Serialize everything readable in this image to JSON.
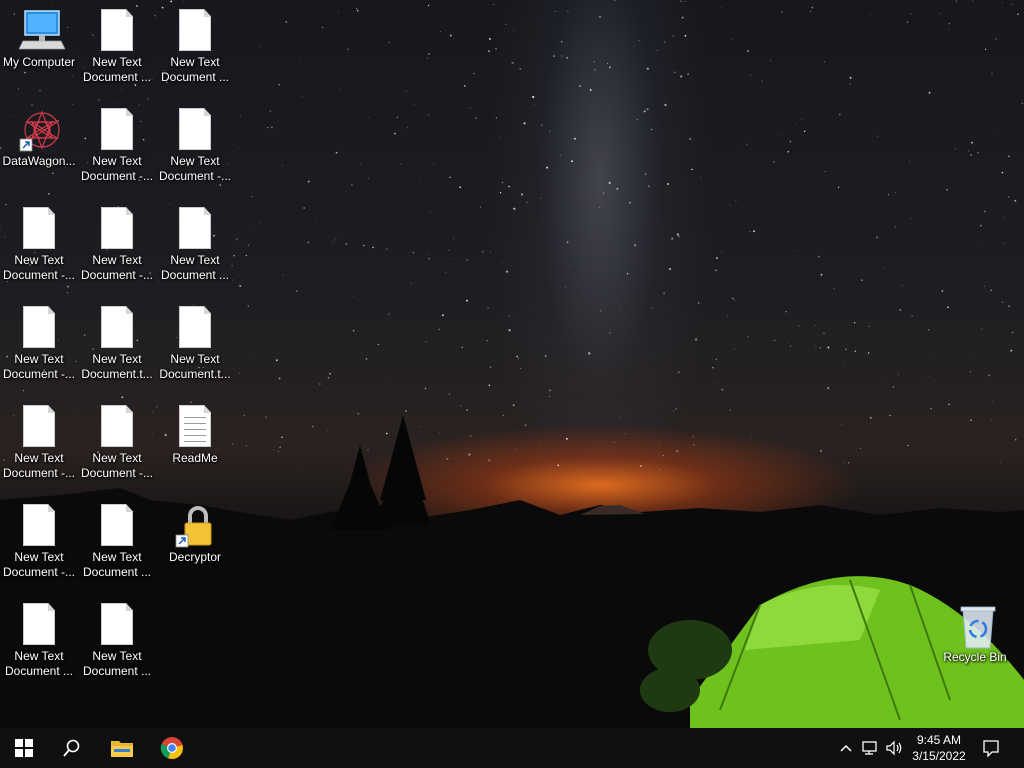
{
  "desktop": {
    "icons": [
      {
        "id": "my-computer",
        "label": "My Computer",
        "type": "computer"
      },
      {
        "id": "datawagon",
        "label": "DataWagon...",
        "type": "app"
      },
      {
        "id": "doc-c1r3",
        "label": "New Text\nDocument -...",
        "type": "doc"
      },
      {
        "id": "doc-c1r4",
        "label": "New Text\nDocument -...",
        "type": "doc"
      },
      {
        "id": "doc-c1r5",
        "label": "New Text\nDocument -...",
        "type": "doc"
      },
      {
        "id": "doc-c1r6",
        "label": "New Text\nDocument -...",
        "type": "doc"
      },
      {
        "id": "doc-c1r7",
        "label": "New Text\nDocument ...",
        "type": "doc"
      },
      {
        "id": "doc-c2r1",
        "label": "New Text\nDocument ...",
        "type": "doc"
      },
      {
        "id": "doc-c2r2",
        "label": "New Text\nDocument -...",
        "type": "doc"
      },
      {
        "id": "doc-c2r3",
        "label": "New Text\nDocument -...",
        "type": "doc"
      },
      {
        "id": "doc-c2r4",
        "label": "New Text\nDocument.t...",
        "type": "doc"
      },
      {
        "id": "doc-c2r5",
        "label": "New Text\nDocument -...",
        "type": "doc"
      },
      {
        "id": "doc-c2r6",
        "label": "New Text\nDocument ...",
        "type": "doc"
      },
      {
        "id": "doc-c2r7",
        "label": "New Text\nDocument ...",
        "type": "doc"
      },
      {
        "id": "doc-c3r1",
        "label": "New Text\nDocument ...",
        "type": "doc"
      },
      {
        "id": "doc-c3r2",
        "label": "New Text\nDocument -...",
        "type": "doc"
      },
      {
        "id": "doc-c3r3",
        "label": "New Text\nDocument ...",
        "type": "doc"
      },
      {
        "id": "doc-c3r4",
        "label": "New Text\nDocument.t...",
        "type": "doc"
      },
      {
        "id": "readme",
        "label": "ReadMe",
        "type": "textfile"
      },
      {
        "id": "decryptor",
        "label": "Decryptor",
        "type": "lock"
      },
      {
        "id": "recycle-bin",
        "label": "Recycle Bin",
        "type": "bin"
      }
    ]
  },
  "taskbar": {
    "start_icon": "windows-logo-icon",
    "search_icon": "search-icon",
    "pinned": [
      {
        "id": "file-explorer",
        "icon": "folder-icon"
      },
      {
        "id": "chrome",
        "icon": "chrome-icon"
      }
    ],
    "tray": {
      "chevron_icon": "chevron-up-icon",
      "network_icon": "network-icon",
      "volume_icon": "speaker-icon",
      "time": "9:45 AM",
      "date": "3/15/2022",
      "notification_icon": "notification-icon"
    }
  },
  "colors": {
    "taskbar": "#101010",
    "tent": "#7ed321",
    "sunset": "#e0701e"
  }
}
